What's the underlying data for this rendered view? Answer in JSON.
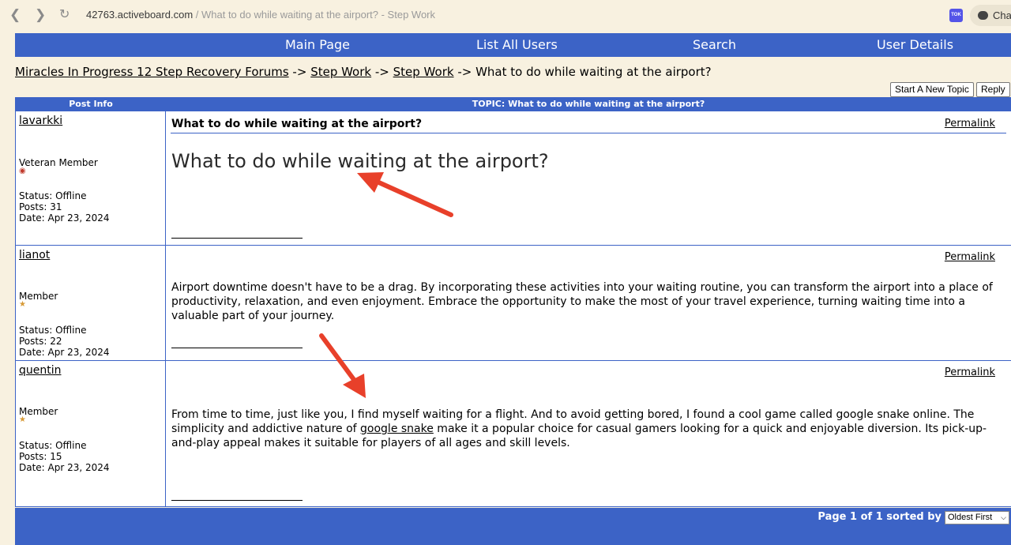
{
  "browser": {
    "domain": "42763.activeboard.com",
    "path": " / What to do while waiting at the airport? - Step Work",
    "ext_label": "TOK",
    "chat_label": "Chat"
  },
  "nav": {
    "main_page": "Main Page",
    "list_users": "List All Users",
    "search": "Search",
    "user_details": "User Details"
  },
  "breadcrumb": {
    "forum": "Miracles In Progress 12 Step Recovery Forums",
    "sep": "->",
    "cat": "Step Work",
    "sub": "Step Work",
    "current": "What to do while waiting at the airport?"
  },
  "buttons": {
    "new_topic": "Start A New Topic",
    "reply": "Reply"
  },
  "thread": {
    "col_info": "Post Info",
    "col_topic": "TOPIC: What to do while waiting at the airport?",
    "permalink": "Permalink",
    "posts": [
      {
        "author": "lavarkki",
        "rank": "Veteran Member",
        "status": "Status: Offline",
        "posts": "Posts: 31",
        "date": "Date: Apr 23, 2024",
        "subject": "What to do while waiting at the airport?",
        "title": "What to do while waiting at the airport?"
      },
      {
        "author": "lianot",
        "rank": "Member",
        "status": "Status: Offline",
        "posts": "Posts: 22",
        "date": "Date: Apr 23, 2024",
        "text": "Airport downtime doesn't have to be a drag. By incorporating these activities into your waiting routine, you can transform the airport into a place of productivity, relaxation, and even enjoyment. Embrace the opportunity to make the most of your travel experience, turning waiting time into a valuable part of your journey."
      },
      {
        "author": "quentin",
        "rank": "Member",
        "status": "Status: Offline",
        "posts": "Posts: 15",
        "date": "Date: Apr 23, 2024",
        "text_a": "From time to time, just like you, I find myself waiting for a flight. And to avoid getting bored, I found a cool game called google snake online. The simplicity and addictive nature of ",
        "link": "google snake",
        "text_b": " make it a popular choice for casual gamers looking for a quick and enjoyable diversion. Its pick-up-and-play appeal makes it suitable for players of all ages and skill levels."
      }
    ]
  },
  "footer": {
    "page": "Page 1 of 1  sorted by",
    "sort": "Oldest First"
  },
  "colors": {
    "accent": "#3c63c6",
    "arrow": "#e8402a",
    "background": "#f8f1e0"
  }
}
